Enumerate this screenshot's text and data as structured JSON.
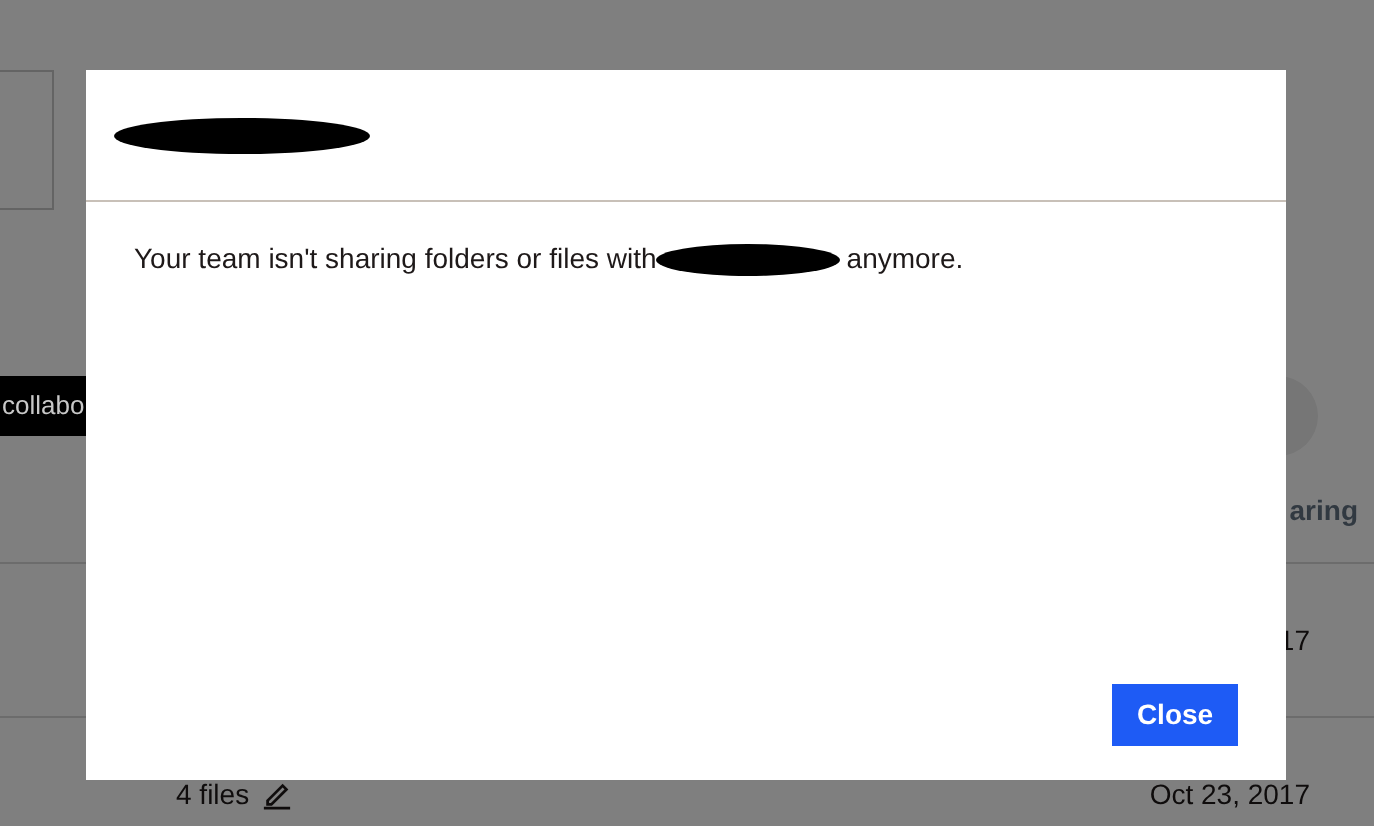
{
  "background": {
    "tooltip": "collabo",
    "column_header": "aring",
    "rows": [
      {
        "column_1": "",
        "date": "17"
      },
      {
        "column_1": "4 files",
        "date": "Oct 23, 2017"
      }
    ]
  },
  "dialog": {
    "title_redacted": true,
    "message_before": "Your team isn't sharing folders or files with",
    "message_redacted": true,
    "message_after": "anymore.",
    "button": "Close"
  }
}
